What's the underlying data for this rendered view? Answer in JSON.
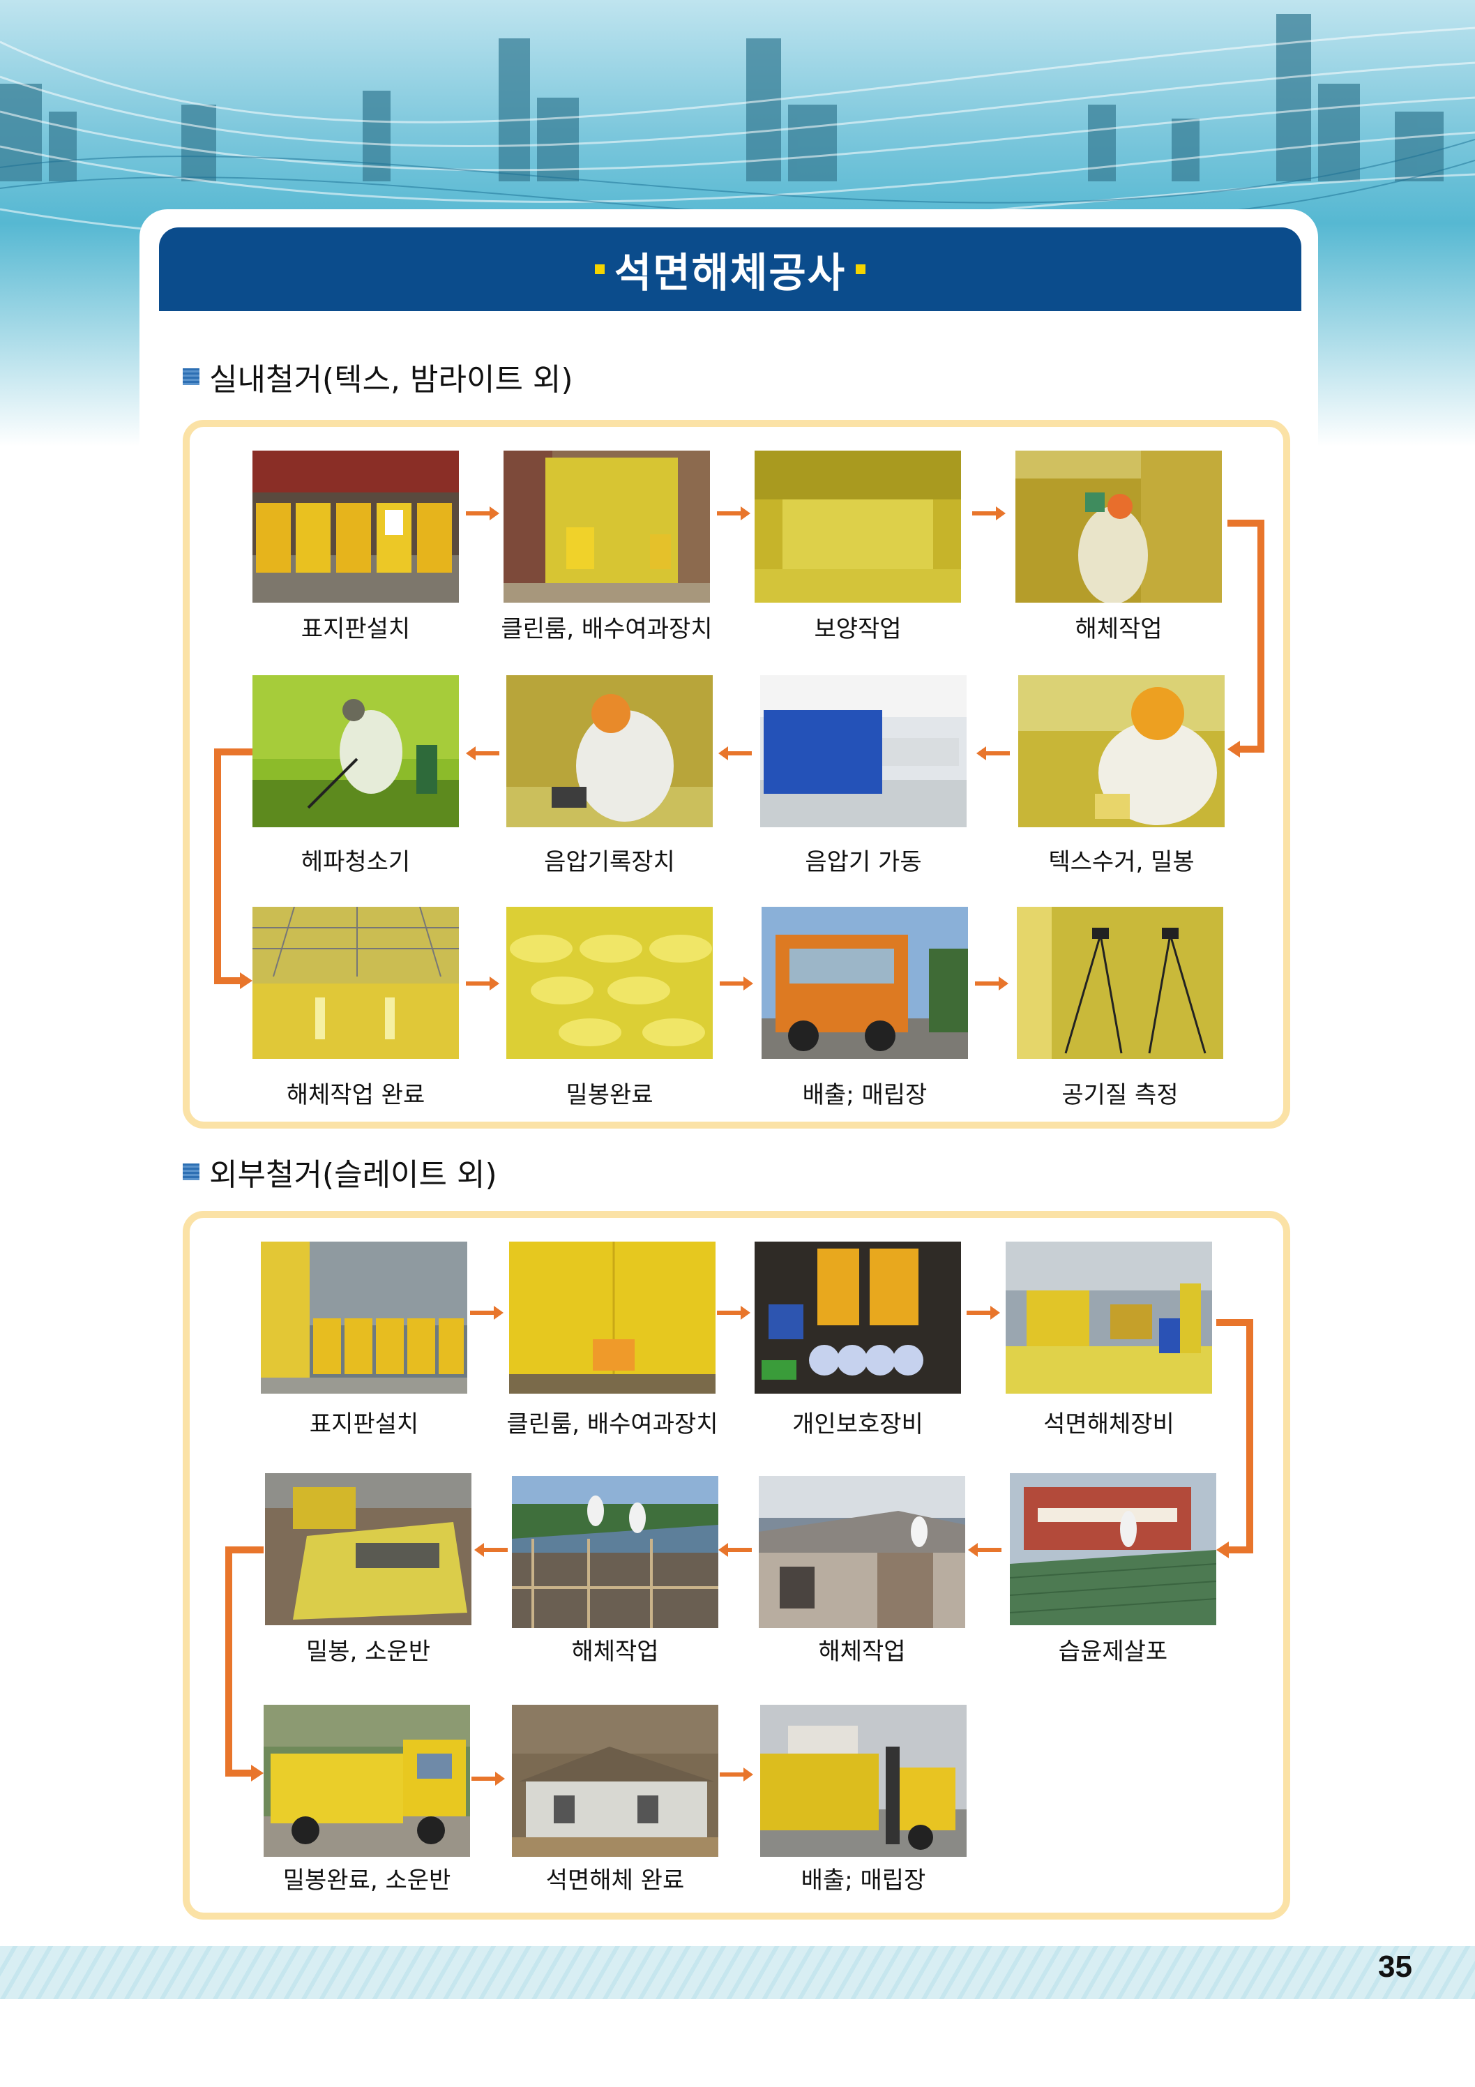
{
  "colors": {
    "title_bar": "#0b4c8c",
    "frame_border": "#fbe2a6",
    "arrow": "#e8752b",
    "accent_square": "#f4d400"
  },
  "title": "석면해체공사",
  "sections": [
    {
      "heading": "실내철거(텍스, 밤라이트 외)",
      "steps": [
        {
          "caption": "표지판설치",
          "photo": "warning-signs-photo"
        },
        {
          "caption": "클린룸, 배수여과장치",
          "photo": "clean-room-photo"
        },
        {
          "caption": "보양작업",
          "photo": "curing-work-photo"
        },
        {
          "caption": "해체작업",
          "photo": "dismantling-photo"
        },
        {
          "caption": "텍스수거, 밀봉",
          "photo": "tex-collection-photo"
        },
        {
          "caption": "음압기 가동",
          "photo": "negative-pressure-machine-photo"
        },
        {
          "caption": "음압기록장치",
          "photo": "pressure-recorder-photo"
        },
        {
          "caption": "헤파청소기",
          "photo": "hepa-vacuum-photo"
        },
        {
          "caption": "해체작업 완료",
          "photo": "dismantling-complete-photo"
        },
        {
          "caption": "밀봉완료",
          "photo": "sealing-complete-photo"
        },
        {
          "caption": "배출; 매립장",
          "photo": "disposal-truck-photo"
        },
        {
          "caption": "공기질 측정",
          "photo": "air-quality-photo"
        }
      ]
    },
    {
      "heading": "외부철거(슬레이트 외)",
      "steps": [
        {
          "caption": "표지판설치",
          "photo": "warning-signs-photo"
        },
        {
          "caption": "클린룸, 배수여과장치",
          "photo": "clean-room-photo"
        },
        {
          "caption": "개인보호장비",
          "photo": "protective-gear-photo"
        },
        {
          "caption": "석면해체장비",
          "photo": "asbestos-equipment-photo"
        },
        {
          "caption": "습윤제살포",
          "photo": "wetting-agent-photo"
        },
        {
          "caption": "해체작업",
          "photo": "dismantling-photo"
        },
        {
          "caption": "해체작업",
          "photo": "dismantling-photo"
        },
        {
          "caption": "밀봉, 소운반",
          "photo": "sealing-transport-photo"
        },
        {
          "caption": "밀봉완료, 소운반",
          "photo": "sealed-truck-photo"
        },
        {
          "caption": "석면해체 완료",
          "photo": "removal-complete-photo"
        },
        {
          "caption": "배출; 매립장",
          "photo": "disposal-forklift-photo"
        }
      ]
    }
  ],
  "page_number": "35"
}
